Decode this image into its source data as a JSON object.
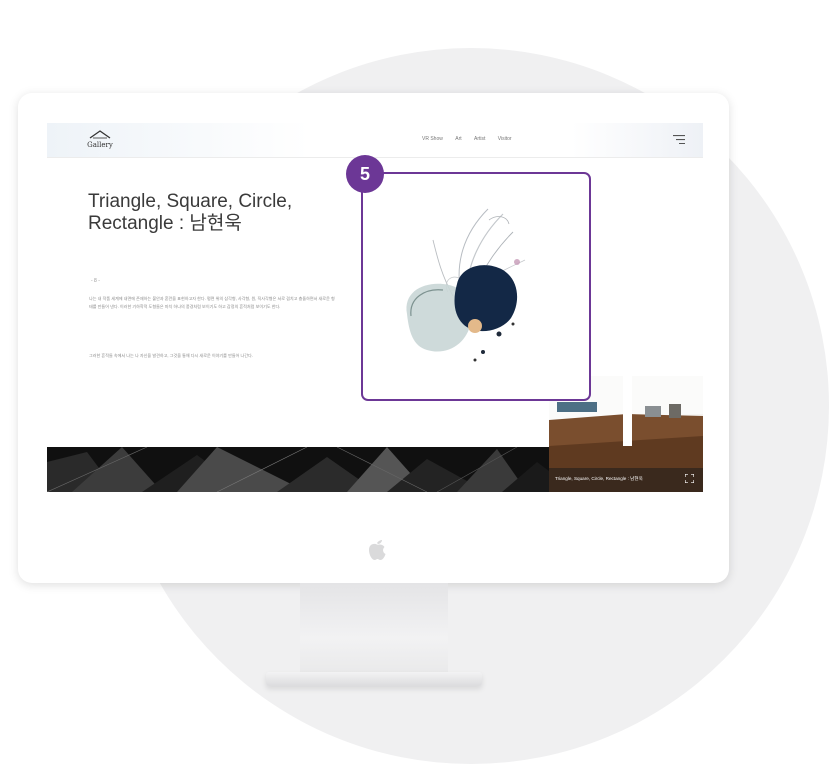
{
  "site": {
    "logo_text": "Gallery",
    "nav": [
      "VR Show",
      "Art",
      "Artist",
      "Visitor"
    ]
  },
  "artwork": {
    "title": "Triangle, Square, Circle, Rectangle : 남현욱",
    "divider": "- 8 -",
    "paragraph_1": "나는 내 작품 세계에 내면에 존재하는 불안과 혼란을 표현하고자 한다. 평면 위의 삼각형, 사각형, 원, 직사각형은 서로 겹치고 충돌하면서 새로운 형태를 만들어 낸다. 이러한 기하학적 도형들은 마치 하나의 풍경처럼 보이기도 하고 감정의 흔적처럼 보이기도 한다.",
    "paragraph_2": "그러한 흔적들 속에서 나는 나 자신을 발견하고, 그것을 통해 다시 새로운 이야기를 만들어 나간다."
  },
  "thumbnail": {
    "caption": "Triangle, Square, Circle, Rectangle : 남현욱"
  },
  "callout": {
    "step_number": "5",
    "color": "#6c3796"
  },
  "icons": [
    "gallery-logo-icon",
    "hamburger-menu-icon",
    "fullscreen-icon",
    "apple-logo-icon"
  ]
}
